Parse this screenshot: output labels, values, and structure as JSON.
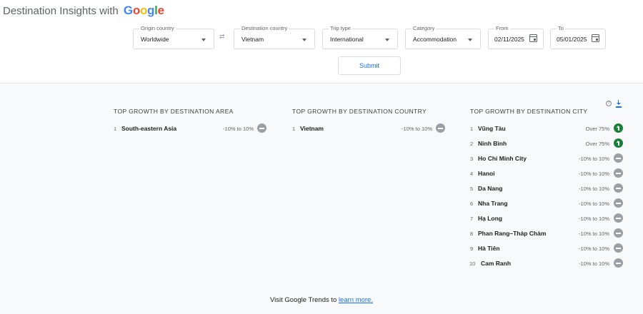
{
  "header": {
    "title_prefix": "Destination Insights with",
    "logo_letters": [
      "G",
      "o",
      "o",
      "g",
      "l",
      "e"
    ]
  },
  "filters": {
    "origin": {
      "label": "Origin country",
      "value": "Worldwide"
    },
    "destination": {
      "label": "Destination country",
      "value": "Vietnam"
    },
    "trip_type": {
      "label": "Trip type",
      "value": "International"
    },
    "category": {
      "label": "Category",
      "value": "Accommodation"
    },
    "from": {
      "label": "From",
      "value": "02/11/2025"
    },
    "to": {
      "label": "To",
      "value": "05/01/2025"
    },
    "submit_label": "Submit"
  },
  "sections": {
    "area": {
      "title": "TOP GROWTH BY DESTINATION AREA",
      "rows": [
        {
          "rank": "1",
          "name": "South-eastern Asia",
          "range": "-10% to 10%",
          "trend": "flat"
        }
      ]
    },
    "country": {
      "title": "TOP GROWTH BY DESTINATION COUNTRY",
      "rows": [
        {
          "rank": "1",
          "name": "Vietnam",
          "range": "-10% to 10%",
          "trend": "flat"
        }
      ]
    },
    "city": {
      "title": "TOP GROWTH BY DESTINATION CITY",
      "rows": [
        {
          "rank": "1",
          "name": "Vũng Tàu",
          "range": "Over 75%",
          "trend": "up"
        },
        {
          "rank": "2",
          "name": "Ninh Bình",
          "range": "Over 75%",
          "trend": "up"
        },
        {
          "rank": "3",
          "name": "Ho Chi Minh City",
          "range": "-10% to 10%",
          "trend": "flat"
        },
        {
          "rank": "4",
          "name": "Hanoi",
          "range": "-10% to 10%",
          "trend": "flat"
        },
        {
          "rank": "5",
          "name": "Da Nang",
          "range": "-10% to 10%",
          "trend": "flat"
        },
        {
          "rank": "6",
          "name": "Nha Trang",
          "range": "-10% to 10%",
          "trend": "flat"
        },
        {
          "rank": "7",
          "name": "Hạ Long",
          "range": "-10% to 10%",
          "trend": "flat"
        },
        {
          "rank": "8",
          "name": "Phan Rang–Tháp Chàm",
          "range": "-10% to 10%",
          "trend": "flat"
        },
        {
          "rank": "9",
          "name": "Hà Tiên",
          "range": "-10% to 10%",
          "trend": "flat"
        },
        {
          "rank": "10",
          "name": "Cam Ranh",
          "range": "-10% to 10%",
          "trend": "flat"
        }
      ]
    }
  },
  "icons": {
    "help": "help-icon",
    "download": "download-icon",
    "swap": "swap-icon",
    "calendar": "calendar-icon",
    "trend_up": "trend-up-icon",
    "trend_flat": "trend-flat-icon"
  },
  "footer": {
    "text": "Visit Google Trends to",
    "link_text": "learn more."
  },
  "colors": {
    "accent": "#1a73e8",
    "trend_up": "#188038",
    "trend_flat": "#9aa0a6",
    "background_main": "#f8f9fa"
  }
}
